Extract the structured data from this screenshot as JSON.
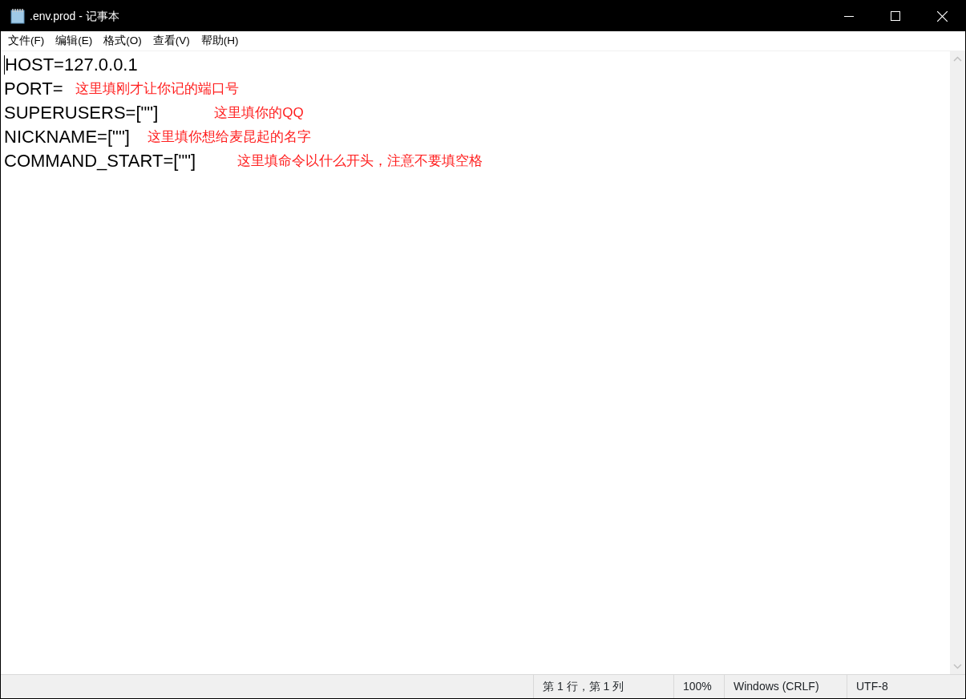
{
  "window": {
    "title": ".env.prod - 记事本"
  },
  "menu": [
    "文件(F)",
    "编辑(E)",
    "格式(O)",
    "查看(V)",
    "帮助(H)"
  ],
  "lines": [
    {
      "code": "HOST=127.0.0.1"
    },
    {
      "code": "PORT=",
      "note": "这里填刚才让你记的端口号"
    },
    {
      "code": "SUPERUSERS=[\"\"]",
      "note": "这里填你的QQ"
    },
    {
      "code": "NICKNAME=[\"\"]",
      "note": "这里填你想给麦昆起的名字"
    },
    {
      "code": "COMMAND_START=[\"\"]",
      "note": "这里填命令以什么开头，注意不要填空格"
    }
  ],
  "status_bar": [
    "第 1 行，第 1 列",
    "100%",
    "Windows (CRLF)",
    "UTF-8"
  ]
}
